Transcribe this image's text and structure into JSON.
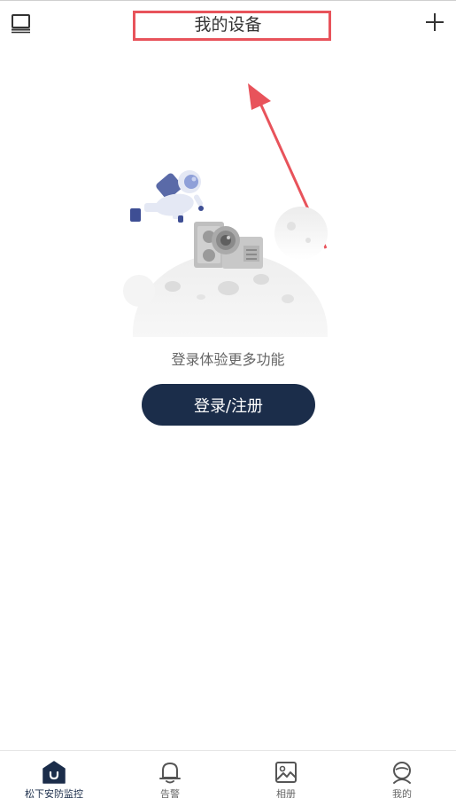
{
  "header": {
    "title": "我的设备",
    "left_icon": "device-list-icon",
    "right_icon": "plus-icon"
  },
  "main": {
    "hint": "登录体验更多功能",
    "login_button": "登录/注册",
    "illustration": "astronaut-camera-moon-illustration"
  },
  "tabs": [
    {
      "label": "松下安防监控",
      "icon": "home-icon",
      "active": true
    },
    {
      "label": "告警",
      "icon": "bell-icon",
      "active": false
    },
    {
      "label": "相册",
      "icon": "gallery-icon",
      "active": false
    },
    {
      "label": "我的",
      "icon": "profile-icon",
      "active": false
    }
  ],
  "colors": {
    "primary": "#1b2d4a",
    "annotation": "#e8535b",
    "text": "#333333",
    "muted": "#666666"
  }
}
